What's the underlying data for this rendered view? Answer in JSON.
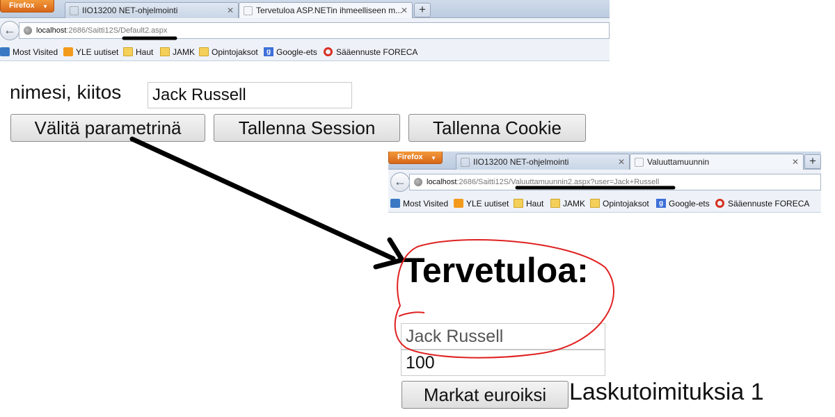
{
  "window1": {
    "firefox_label": "Firefox",
    "tabs": [
      {
        "title": "IIO13200 NET-ohjelmointi"
      },
      {
        "title": "Tervetuloa ASP.NETin ihmeelliseen m..."
      }
    ],
    "url": {
      "host": "localhost",
      "path": ":2686/Saitti12S/Default2.aspx"
    },
    "bookmarks": [
      "Most Visited",
      "YLE uutiset",
      "Haut",
      "JAMK",
      "Opintojaksot",
      "Google-ets",
      "Sääennuste FORECA"
    ],
    "page": {
      "name_label": "nimesi, kiitos",
      "name_value": "Jack Russell",
      "buttons": [
        "Välitä parametrinä",
        "Tallenna Session",
        "Tallenna Cookie"
      ]
    }
  },
  "window2": {
    "firefox_label": "Firefox",
    "tabs": [
      {
        "title": "IIO13200 NET-ohjelmointi"
      },
      {
        "title": "Valuuttamuunnin"
      }
    ],
    "url": {
      "host": "localhost",
      "path": ":2686/Saitti12S/Valuuttamuunnin2.aspx?user=Jack+Russell"
    },
    "bookmarks": [
      "Most Visited",
      "YLE uutiset",
      "Haut",
      "JAMK",
      "Opintojaksot",
      "Google-ets",
      "Sääennuste FORECA"
    ],
    "page": {
      "heading": "Tervetuloa:",
      "user_value": "Jack Russell",
      "amount_value": "100",
      "convert_button": "Markat euroiksi",
      "result_text": "Laskutoimituksia 1"
    }
  },
  "colors": {
    "annotation_arrow": "#000000",
    "annotation_circle": "#e02020"
  }
}
